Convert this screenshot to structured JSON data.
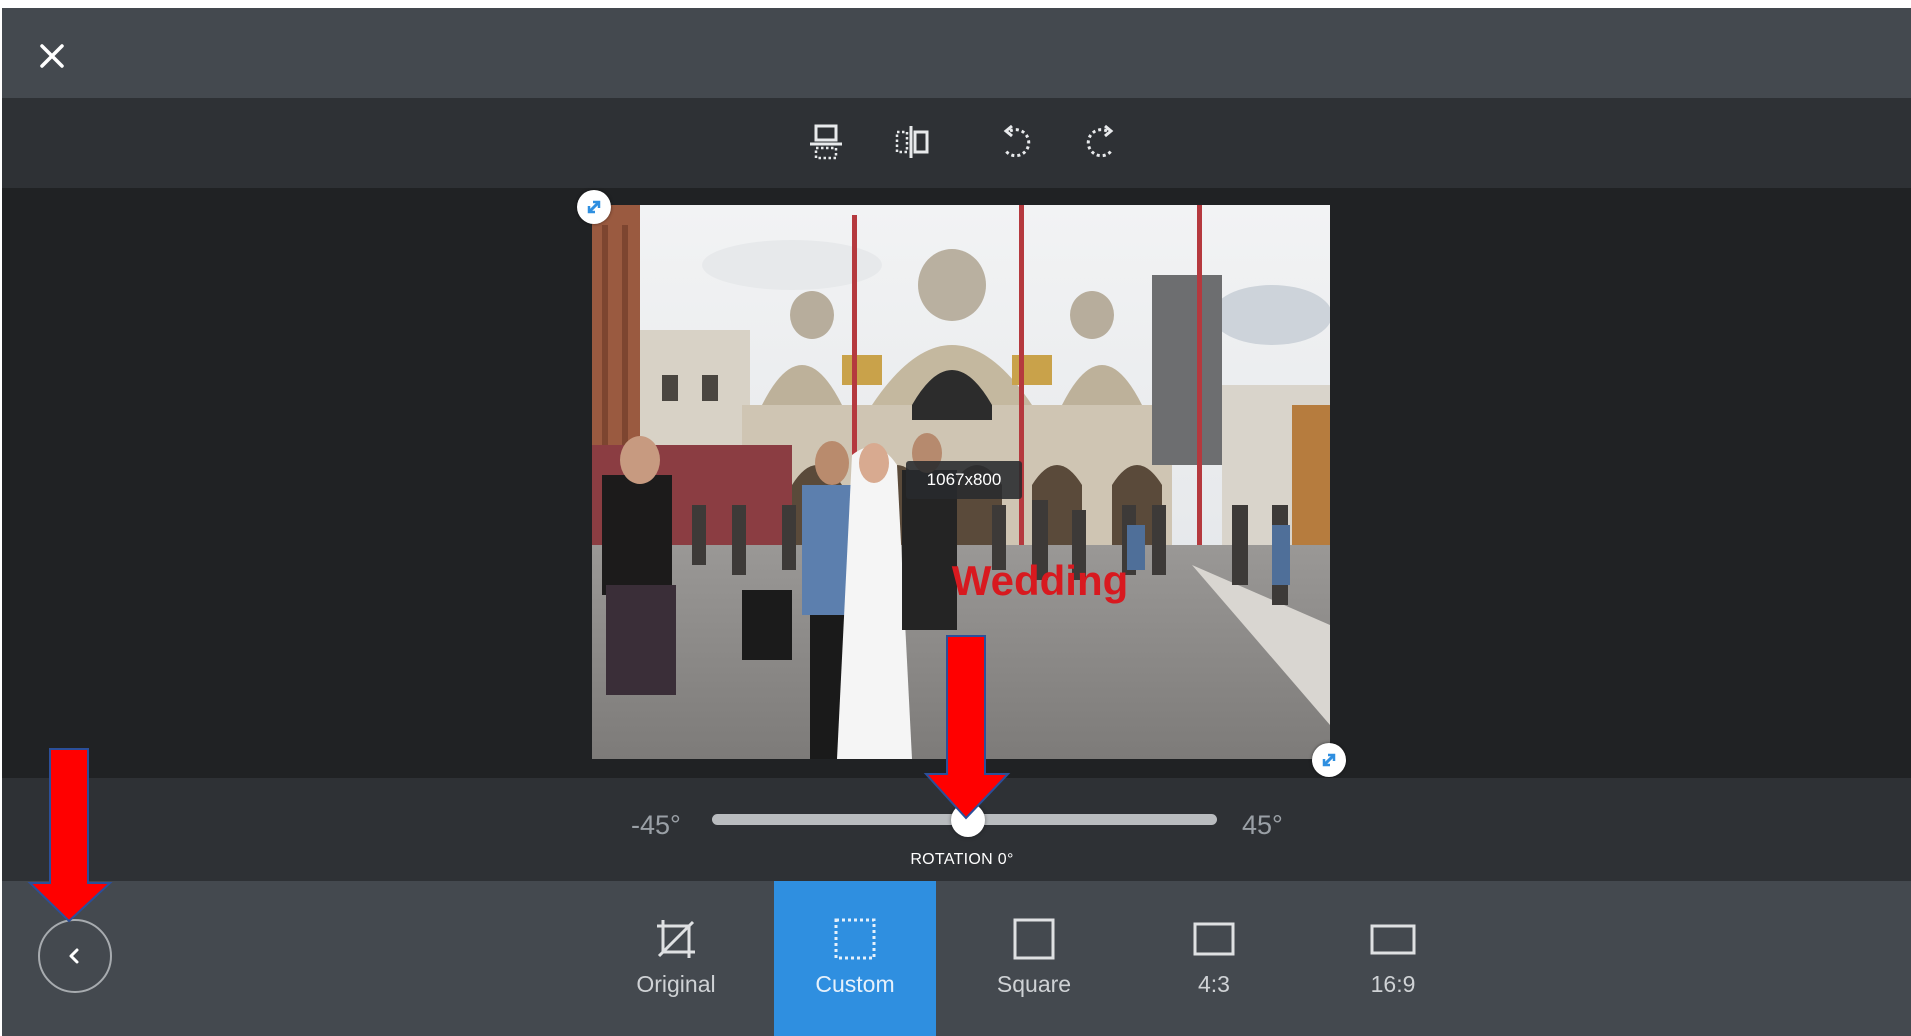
{
  "colors": {
    "accent": "#2f8fe0",
    "arrow": "#ff0000",
    "arrow_outline": "#2b4f9a",
    "bar": "#44494f",
    "toolbar": "#2e3135",
    "canvas": "#202224"
  },
  "topbar": {
    "close_icon": "close-icon"
  },
  "toolbar": {
    "tools": [
      {
        "name": "flip-vertical-icon"
      },
      {
        "name": "flip-horizontal-icon"
      },
      {
        "name": "rotate-left-icon"
      },
      {
        "name": "rotate-right-icon"
      }
    ]
  },
  "canvas": {
    "dimensions": "1067x800",
    "photo_text": "Wedding"
  },
  "rotation": {
    "min_label": "-45°",
    "max_label": "45°",
    "label": "ROTATION 0°",
    "value_degrees": 0,
    "min": -45,
    "max": 45
  },
  "bottombar": {
    "aspects": [
      {
        "label": "Original",
        "icon": "no-crop-icon",
        "active": false
      },
      {
        "label": "Custom",
        "icon": "custom-crop-icon",
        "active": true
      },
      {
        "label": "Square",
        "icon": "square-icon",
        "active": false
      },
      {
        "label": "4:3",
        "icon": "ratio-4-3-icon",
        "active": false
      },
      {
        "label": "16:9",
        "icon": "ratio-16-9-icon",
        "active": false
      }
    ]
  }
}
